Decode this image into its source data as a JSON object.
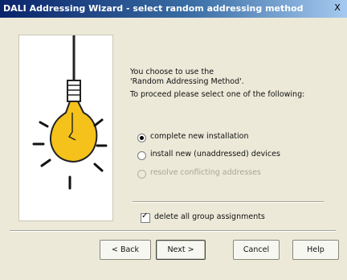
{
  "window": {
    "title": "DALI Addressing Wizard - select random addressing method",
    "close": "X"
  },
  "content": {
    "intro_line1": "You choose to use the",
    "intro_line2": "'Random Addressing Method'.",
    "instruction": "To proceed please select one of the following:",
    "options": [
      {
        "label": "complete new installation",
        "selected": true,
        "enabled": true
      },
      {
        "label": "install new (unaddressed) devices",
        "selected": false,
        "enabled": true
      },
      {
        "label": "resolve conflicting addresses",
        "selected": false,
        "enabled": false
      }
    ],
    "checkbox": {
      "label": "delete all group assignments",
      "checked": true
    }
  },
  "buttons": {
    "back": "< Back",
    "next": "Next >",
    "cancel": "Cancel",
    "help": "Help"
  },
  "colors": {
    "title_bar_start": "#0a246a",
    "title_bar_end": "#a6caf0",
    "bulb_yellow": "#f4c21a"
  },
  "icons": {
    "illustration": "light-bulb-illustration"
  }
}
